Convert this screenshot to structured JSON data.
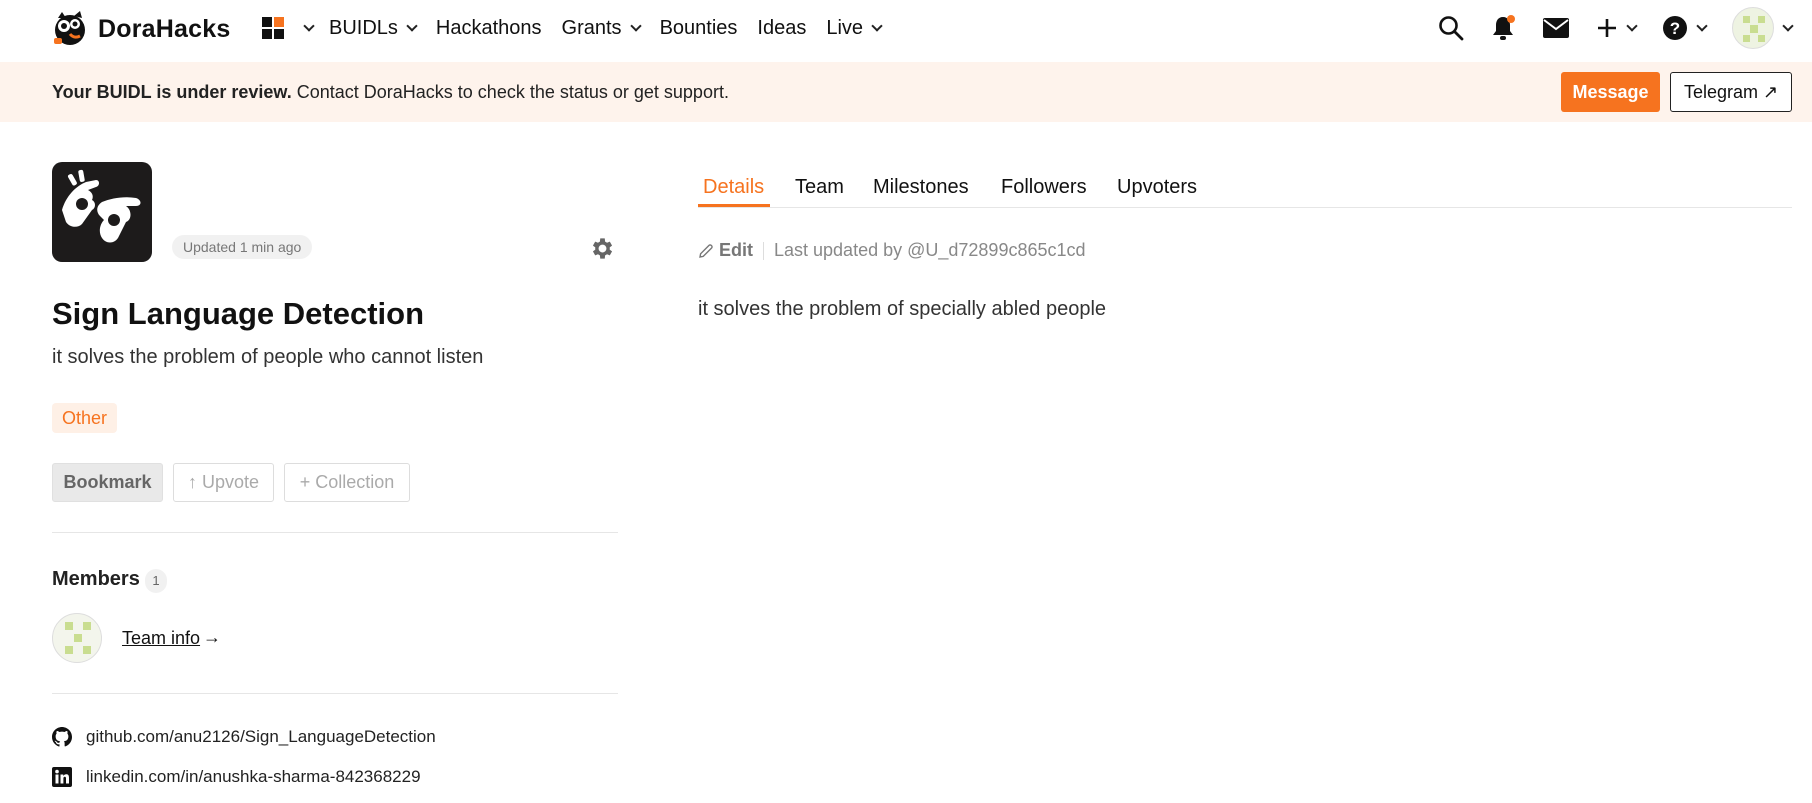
{
  "nav": {
    "brand": "DoraHacks",
    "items": [
      {
        "label": "BUIDLs",
        "has_dropdown": true
      },
      {
        "label": "Hackathons",
        "has_dropdown": false
      },
      {
        "label": "Grants",
        "has_dropdown": true
      },
      {
        "label": "Bounties",
        "has_dropdown": false
      },
      {
        "label": "Ideas",
        "has_dropdown": false
      },
      {
        "label": "Live",
        "has_dropdown": true
      }
    ],
    "right_icons": [
      "search-icon",
      "bell-icon",
      "mail-icon",
      "plus-icon",
      "help-icon",
      "avatar"
    ],
    "notification_dot_color": "#f6731f"
  },
  "banner": {
    "bold_text": "Your BUIDL is under review.",
    "text": " Contact DoraHacks to check the status or get support.",
    "message_label": "Message",
    "telegram_label": "Telegram ↗",
    "background": "#fef3ec"
  },
  "project": {
    "updated": "Updated 1 min ago",
    "title": "Sign Language Detection",
    "tagline": "it solves the problem of people who cannot listen",
    "tag": "Other",
    "actions": {
      "bookmark": "Bookmark",
      "upvote": "↑ Upvote",
      "collection": "+ Collection"
    },
    "members_label": "Members",
    "members_count": "1",
    "team_info": "Team info",
    "team_arrow": "→",
    "links": [
      {
        "icon": "github-icon",
        "text": "github.com/anu2126/Sign_LanguageDetection"
      },
      {
        "icon": "linkedin-icon",
        "text": "linkedin.com/in/anushka-sharma-842368229"
      }
    ]
  },
  "tabs": [
    {
      "label": "Details",
      "active": true
    },
    {
      "label": "Team",
      "active": false
    },
    {
      "label": "Milestones",
      "active": false
    },
    {
      "label": "Followers",
      "active": false
    },
    {
      "label": "Upvoters",
      "active": false
    }
  ],
  "details": {
    "edit_label": "Edit",
    "last_updated": "Last updated by @U_d72899c865c1cd",
    "body": "it solves the problem of specially abled people"
  },
  "colors": {
    "accent": "#f6731f",
    "tag_bg": "#fef0e6"
  }
}
